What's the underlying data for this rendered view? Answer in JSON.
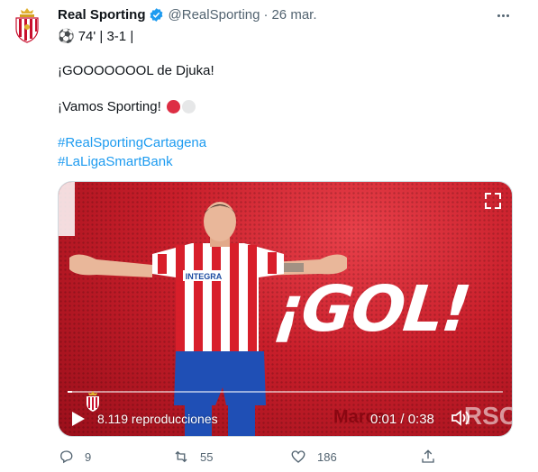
{
  "tweet": {
    "author_name": "Real Sporting",
    "handle": "@RealSporting",
    "separator": "·",
    "date": "26 mar.",
    "score_line": "74'  | 3-1 |",
    "text_line_1": "¡GOOOOOOOL de Djuka!",
    "text_line_2": "¡Vamos Sporting!",
    "hashtags": [
      "#RealSportingCartagena",
      "#LaLigaSmartBank"
    ],
    "colors": {
      "red_circle": "#dd2e44",
      "white_circle": "#e6e7e8",
      "link": "#1d9bf0",
      "verified": "#1d9bf0"
    }
  },
  "video": {
    "overlay_text": "¡GOL!",
    "jersey_text": "INTEGRA",
    "views": "8.119 reproducciones",
    "time": "0:01 / 0:38",
    "watermark": "Marca",
    "corner_text": "RSC",
    "progress": 0.01,
    "icons": {
      "play": "play-icon",
      "volume": "volume-icon",
      "expand": "expand-icon"
    }
  },
  "actions": {
    "reply_count": "9",
    "retweet_count": "55",
    "like_count": "186"
  }
}
